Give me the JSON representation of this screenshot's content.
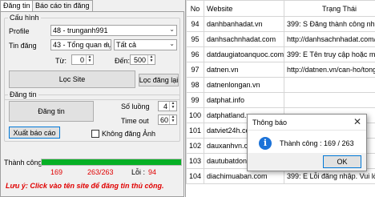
{
  "tabs": [
    {
      "label": "Đăng tin",
      "active": true
    },
    {
      "label": "Báo cáo tin đăng",
      "active": false
    }
  ],
  "config_group": {
    "title": "Cấu hình",
    "profile_label": "Profile",
    "profile_value": "48 - trunganh991",
    "category_label": "Tin đăng",
    "category_value": "43 - Tổng quan dự án F",
    "category_filter_value": "Tất cả",
    "from_label": "Từ:",
    "from_value": "0",
    "to_label": "Đến:",
    "to_value": "500",
    "filter_site_button": "Lọc Site",
    "refilter_button": "Lọc đăng lại"
  },
  "post_group": {
    "title": "Đăng tin",
    "post_button": "Đăng tin",
    "thread_count_label": "Số luồng",
    "thread_count_value": "4",
    "timeout_label": "Time out",
    "timeout_value": "60",
    "export_report_button": "Xuất báo cáo",
    "no_image_label": "Không đăng Ảnh",
    "no_image_checked": false
  },
  "progress": {
    "success_label": "Thành công :",
    "fraction_complete": 1.0,
    "success_count": "169",
    "total_count": "263/263",
    "error_label": "Lỗi :",
    "error_count": "94"
  },
  "note": "Lưu ý: Click vào tên site để đăng tin thủ công.",
  "table": {
    "columns": [
      "No",
      "Website",
      "Trạng Thái"
    ],
    "rows": [
      {
        "no": "94",
        "website": "danhbanhadat.vn",
        "status": "399: S Đăng thành công nhưng chưa"
      },
      {
        "no": "95",
        "website": "danhsachnhadat.com",
        "status": "http://danhsachnhadat.com/tong-qu"
      },
      {
        "no": "96",
        "website": "datdaugiatoanquoc.com",
        "status": "399: E Tên truy cập hoặc mật khẩu k"
      },
      {
        "no": "97",
        "website": "datnen.vn",
        "status": "http://datnen.vn/can-ho/tong-quan-"
      },
      {
        "no": "98",
        "website": "datnenlongan.vn",
        "status": ""
      },
      {
        "no": "99",
        "website": "datphat.info",
        "status": ""
      },
      {
        "no": "100",
        "website": "datphatland.vn",
        "status": ""
      },
      {
        "no": "101",
        "website": "datviet24h.com",
        "status": ""
      },
      {
        "no": "102",
        "website": "dauxanhvn.com",
        "status": ""
      },
      {
        "no": "103",
        "website": "dautubatdongsan.com",
        "status": "Ví"
      },
      {
        "no": "104",
        "website": "diachimuaban.com",
        "status": "399: E Lỗi đăng nhập. Vui lòng KIỂM"
      }
    ]
  },
  "dialog": {
    "title": "Thông báo",
    "message": "Thành công : 169 / 263",
    "ok_button": "OK"
  },
  "colors": {
    "progress_fill": "#06b025",
    "error_text": "#e00000",
    "info_icon": "#1b72d8",
    "focus_border": "#0078d7"
  }
}
